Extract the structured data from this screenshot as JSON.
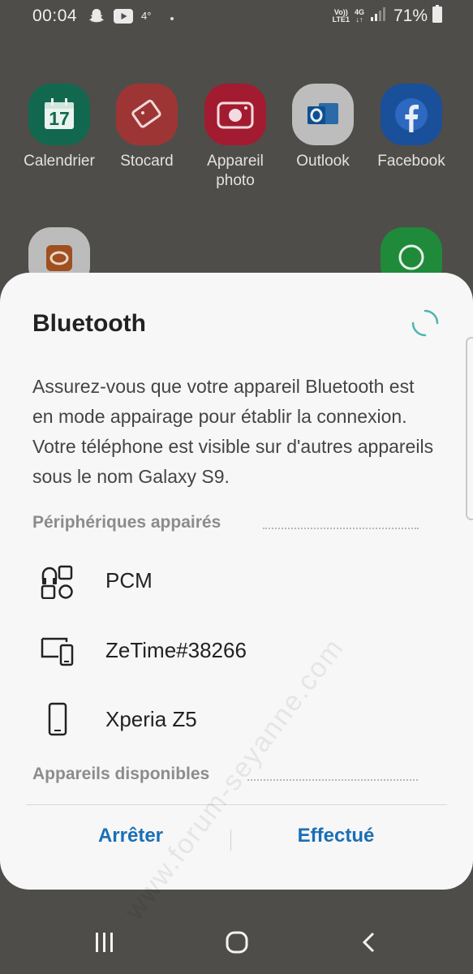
{
  "status_bar": {
    "time": "00:04",
    "temperature": "4°",
    "volte_label": "Vo)) LTE1",
    "network_type": "4G",
    "battery_percent": "71%"
  },
  "home_apps_row1": [
    {
      "label": "Calendrier",
      "icon": "calendar-icon",
      "color": "#0e7a60"
    },
    {
      "label": "Stocard",
      "icon": "stocard-icon",
      "color": "#d84a4a"
    },
    {
      "label": "Appareil photo",
      "icon": "camera-icon",
      "color": "#d8243e"
    },
    {
      "label": "Outlook",
      "icon": "outlook-icon",
      "color": "#ffffff"
    },
    {
      "label": "Facebook",
      "icon": "facebook-icon",
      "color": "#1877f2"
    }
  ],
  "calendar_day": "17",
  "dialog": {
    "title": "Bluetooth",
    "description": "Assurez-vous que votre appareil Bluetooth est en mode appairage pour établir la connexion. Votre téléphone est visible sur d'autres appareils sous le nom Galaxy S9.",
    "paired_header": "Périphériques appairés",
    "paired_devices": [
      {
        "label": "PCM",
        "icon": "device-multi-icon"
      },
      {
        "label": "ZeTime#38266",
        "icon": "devices-icon"
      },
      {
        "label": "Xperia Z5",
        "icon": "smartphone-icon"
      }
    ],
    "available_header": "Appareils disponibles",
    "stop_button": "Arrêter",
    "done_button": "Effectué",
    "accent_color": "#1a6fb6"
  },
  "watermark": "www.forum-seyanne.com"
}
